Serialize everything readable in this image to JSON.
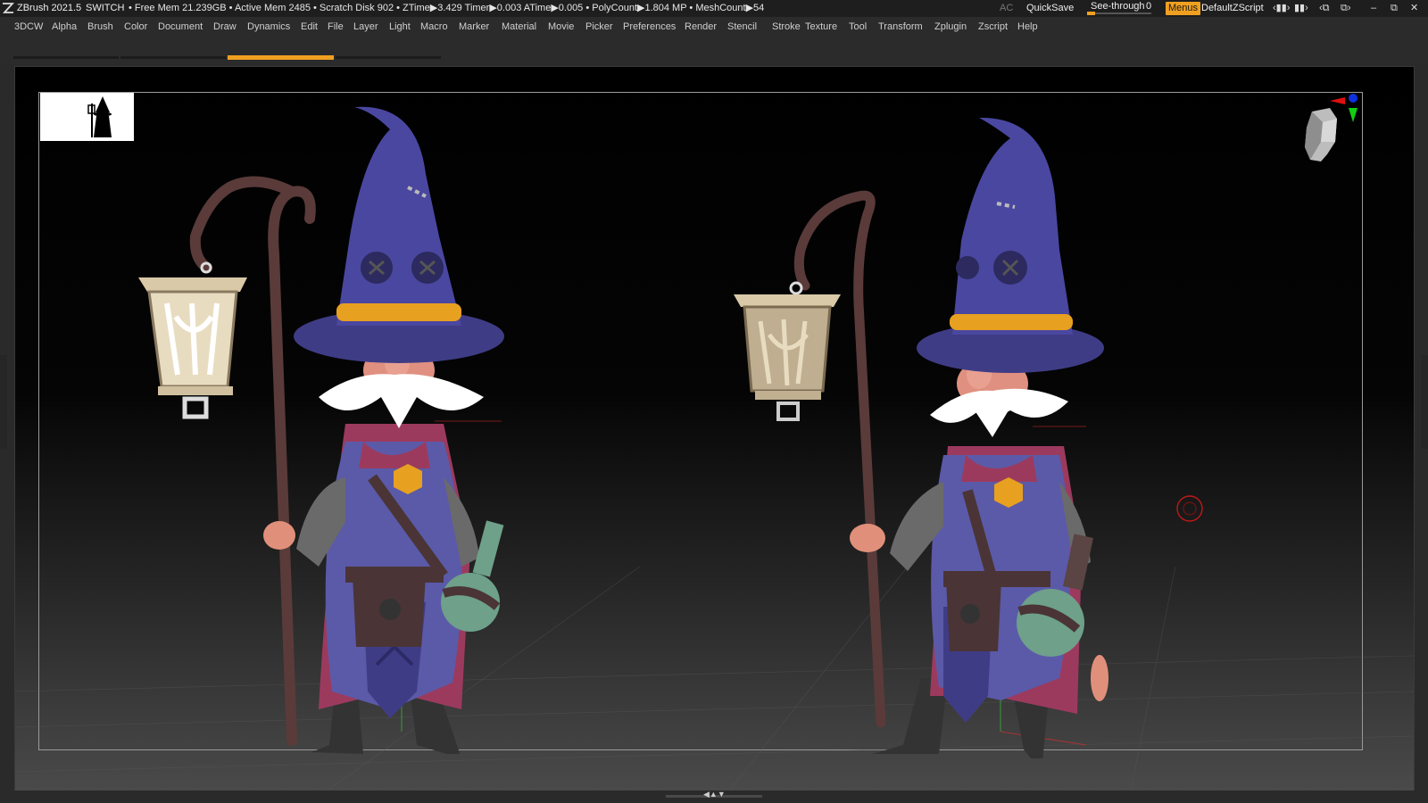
{
  "titlebar": {
    "app_name": "ZBrush 2021.5",
    "switch_label": "SWITCH",
    "stats": "• Free Mem 21.239GB • Active Mem 2485 • Scratch Disk 902 •  ZTime▶3.429 Timer▶0.003 ATime▶0.005 • PolyCount▶1.804 MP  • MeshCount▶54",
    "ac_label": "AC",
    "quicksave_label": "QuickSave",
    "seethrough_label": "See-through",
    "seethrough_value": "0",
    "menus_label": "Menus",
    "script_label": "DefaultZScript"
  },
  "menubar": {
    "items": [
      "3DCW",
      "Alpha",
      "Brush",
      "Color",
      "Document",
      "Draw",
      "Dynamics",
      "Edit",
      "File",
      "Layer",
      "Light",
      "Macro",
      "Marker",
      "Material",
      "Movie",
      "Picker",
      "Preferences",
      "Render",
      "Stencil",
      "Stroke",
      "Texture",
      "Tool",
      "Transform",
      "Zplugin",
      "Zscript",
      "Help"
    ]
  },
  "colors": {
    "accent": "#f0a020",
    "robe": "#5b5aa8",
    "hat": "#3f3c86",
    "hat_band": "#e8a020",
    "cape": "#9c3a5e",
    "staff": "#5a3b3a",
    "lantern": "#d9c9a8"
  },
  "icons": [
    "zbrush-logo-icon",
    "layout-icon",
    "camera-icon",
    "minimize-icon",
    "restore-icon",
    "close-icon",
    "navigation-head-icon",
    "axis-gizmo-icon",
    "brush-cursor-icon",
    "wizard-silhouette-icon"
  ]
}
